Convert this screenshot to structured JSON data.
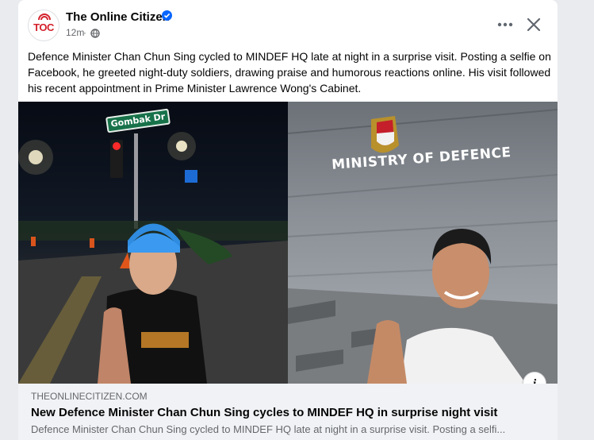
{
  "post": {
    "page_name": "The Online Citizen",
    "time": "12m",
    "meta_separator": "·",
    "avatar_text": "TOC",
    "body": "Defence Minister Chan Chun Sing cycled to MINDEF HQ late at night in a surprise visit. Posting a selfie on Facebook, he greeted night-duty soldiers, drawing praise and humorous reactions online. His visit followed his recent appointment in Prime Minister Lawrence Wong's Cabinet."
  },
  "media": {
    "left_sign_text": "Gombak Dr",
    "right_wall_text": "MINISTRY OF DEFENCE",
    "info_button_label": "i"
  },
  "link_preview": {
    "domain": "THEONLINECITIZEN.COM",
    "title": "New Defence Minister Chan Chun Sing cycles to MINDEF HQ in surprise night visit",
    "description": "Defence Minister Chan Chun Sing cycled to MINDEF HQ late at night in a surprise visit. Posting a selfi..."
  },
  "icons": {
    "verified": "verified-badge-icon",
    "privacy": "globe-icon",
    "more": "more-options-icon",
    "close": "close-icon",
    "info": "info-icon"
  },
  "colors": {
    "brand_red": "#d4202a",
    "verified_blue": "#0866ff",
    "text_primary": "#050505",
    "text_secondary": "#65676b",
    "link_bg": "#f0f2f5"
  }
}
